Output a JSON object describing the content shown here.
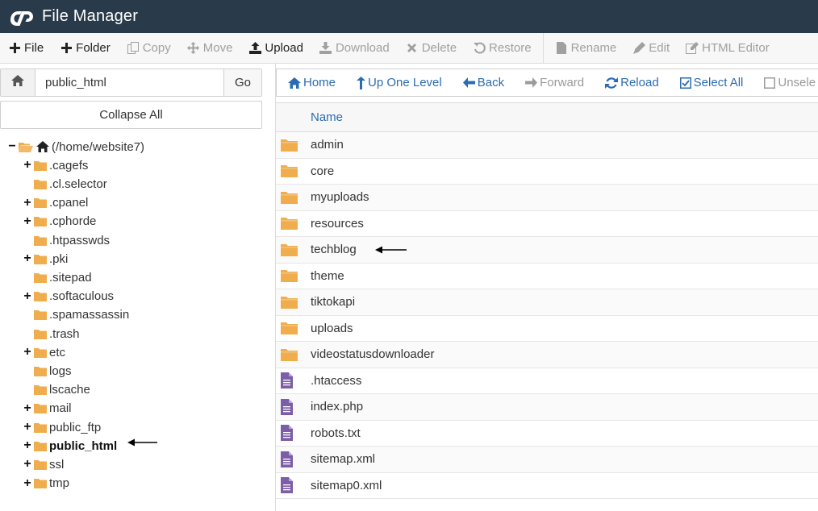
{
  "header": {
    "title": "File Manager"
  },
  "toolbar": {
    "items": [
      {
        "label": "File",
        "enabled": true,
        "icon": "plus-icon"
      },
      {
        "label": "Folder",
        "enabled": true,
        "icon": "plus-icon"
      },
      {
        "label": "Copy",
        "enabled": false,
        "icon": "copy-icon"
      },
      {
        "label": "Move",
        "enabled": false,
        "icon": "move-icon"
      },
      {
        "label": "Upload",
        "enabled": true,
        "icon": "upload-icon"
      },
      {
        "label": "Download",
        "enabled": false,
        "icon": "download-icon"
      },
      {
        "label": "Delete",
        "enabled": false,
        "icon": "delete-icon"
      },
      {
        "label": "Restore",
        "enabled": false,
        "icon": "restore-icon"
      },
      {
        "label": "Rename",
        "enabled": false,
        "icon": "rename-icon"
      },
      {
        "label": "Edit",
        "enabled": false,
        "icon": "edit-icon"
      },
      {
        "label": "HTML Editor",
        "enabled": false,
        "icon": "html-editor-icon"
      }
    ]
  },
  "left": {
    "path_value": "public_html",
    "go_label": "Go",
    "collapse_label": "Collapse All"
  },
  "tree": [
    {
      "label": "(/home/website7)",
      "toggle": "−",
      "root": true
    },
    {
      "label": ".cagefs",
      "toggle": "+"
    },
    {
      "label": ".cl.selector",
      "toggle": ""
    },
    {
      "label": ".cpanel",
      "toggle": "+"
    },
    {
      "label": ".cphorde",
      "toggle": "+"
    },
    {
      "label": ".htpasswds",
      "toggle": ""
    },
    {
      "label": ".pki",
      "toggle": "+"
    },
    {
      "label": ".sitepad",
      "toggle": ""
    },
    {
      "label": ".softaculous",
      "toggle": "+"
    },
    {
      "label": ".spamassassin",
      "toggle": ""
    },
    {
      "label": ".trash",
      "toggle": ""
    },
    {
      "label": "etc",
      "toggle": "+"
    },
    {
      "label": "logs",
      "toggle": ""
    },
    {
      "label": "lscache",
      "toggle": ""
    },
    {
      "label": "mail",
      "toggle": "+"
    },
    {
      "label": "public_ftp",
      "toggle": "+"
    },
    {
      "label": "public_html",
      "toggle": "+",
      "bold": true,
      "arrow": true
    },
    {
      "label": "ssl",
      "toggle": "+"
    },
    {
      "label": "tmp",
      "toggle": "+"
    }
  ],
  "nav": {
    "items": [
      {
        "label": "Home",
        "enabled": true,
        "icon": "home-icon"
      },
      {
        "label": "Up One Level",
        "enabled": true,
        "icon": "up-arrow-icon"
      },
      {
        "label": "Back",
        "enabled": true,
        "icon": "back-arrow-icon"
      },
      {
        "label": "Forward",
        "enabled": false,
        "icon": "forward-arrow-icon"
      },
      {
        "label": "Reload",
        "enabled": true,
        "icon": "reload-icon"
      },
      {
        "label": "Select All",
        "enabled": true,
        "icon": "checkbox-checked-icon"
      },
      {
        "label": "Unsele",
        "enabled": false,
        "icon": "checkbox-empty-icon"
      }
    ]
  },
  "table": {
    "header_name": "Name",
    "rows": [
      {
        "name": "admin",
        "type": "folder"
      },
      {
        "name": "core",
        "type": "folder"
      },
      {
        "name": "myuploads",
        "type": "folder"
      },
      {
        "name": "resources",
        "type": "folder"
      },
      {
        "name": "techblog",
        "type": "folder",
        "arrow": true
      },
      {
        "name": "theme",
        "type": "folder"
      },
      {
        "name": "tiktokapi",
        "type": "folder"
      },
      {
        "name": "uploads",
        "type": "folder"
      },
      {
        "name": "videostatusdownloader",
        "type": "folder"
      },
      {
        "name": ".htaccess",
        "type": "file"
      },
      {
        "name": "index.php",
        "type": "file"
      },
      {
        "name": "robots.txt",
        "type": "file"
      },
      {
        "name": "sitemap.xml",
        "type": "file"
      },
      {
        "name": "sitemap0.xml",
        "type": "file"
      }
    ]
  },
  "colors": {
    "header_bg": "#293a4a",
    "folder": "#f0ad4e",
    "file": "#7b5ea7",
    "link": "#2a6cb3"
  }
}
